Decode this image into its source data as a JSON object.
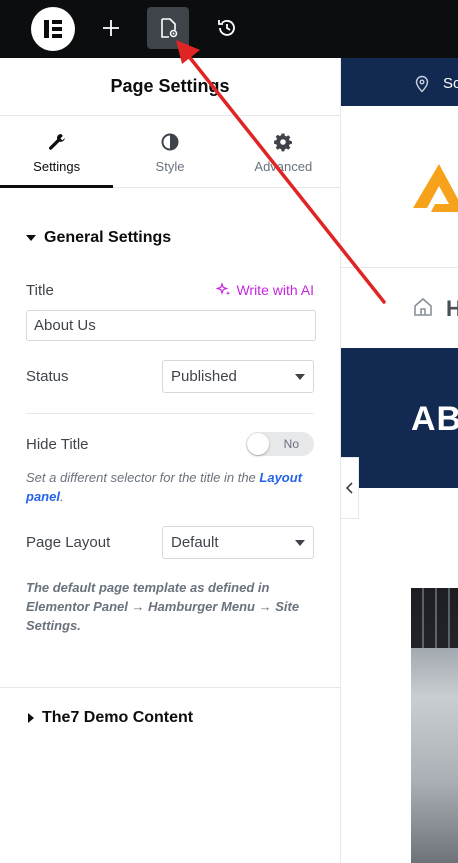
{
  "topbar": {
    "logo_icon": "elementor-logo-icon",
    "add_icon": "plus-icon",
    "page_settings_icon": "page-settings-icon",
    "history_icon": "history-icon"
  },
  "panel": {
    "title": "Page Settings",
    "tabs": [
      {
        "label": "Settings",
        "icon": "wrench-icon",
        "active": true
      },
      {
        "label": "Style",
        "icon": "half-circle-icon",
        "active": false
      },
      {
        "label": "Advanced",
        "icon": "gear-icon",
        "active": false
      }
    ],
    "general": {
      "section_title": "General Settings",
      "title_label": "Title",
      "ai_link": "Write with AI",
      "title_value": "About Us",
      "status_label": "Status",
      "status_value": "Published",
      "hide_title_label": "Hide Title",
      "hide_title_toggle": "No",
      "hide_title_desc_prefix": "Set a different selector for the title in the ",
      "hide_title_desc_link": "Layout panel",
      "hide_title_desc_suffix": ".",
      "page_layout_label": "Page Layout",
      "page_layout_value": "Default",
      "page_layout_desc": "The default page template as defined in Elementor Panel → Hamburger Menu → Site Settings."
    },
    "demo_section_title": "The7 Demo Content"
  },
  "preview": {
    "top_text": "So",
    "breadcrumb_letter": "H",
    "heading": "AB"
  },
  "colors": {
    "topbar": "#0c0d0e",
    "accent_ai": "#c626e0",
    "link": "#2563eb",
    "preview_navy": "#122a52",
    "logo_orange": "#f7a21b",
    "annotation_arrow": "#e02424"
  }
}
